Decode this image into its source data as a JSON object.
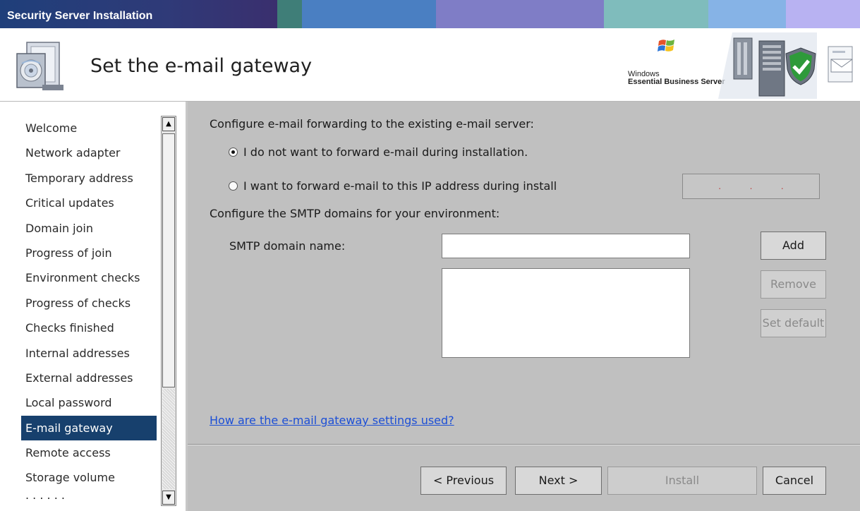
{
  "window": {
    "title": "Security Server Installation"
  },
  "colors": {
    "title_segments": [
      "#1f3f78",
      "#2d3b7c",
      "#3a2f6e",
      "#3f7e78",
      "#4a7fc2",
      "#7a7cc4",
      "#8f8dd0",
      "#7fbcbc",
      "#86b3e6",
      "#b4b0f0"
    ]
  },
  "header": {
    "page_title": "Set the e-mail gateway",
    "logo_line1": "Windows",
    "logo_line2": "Essential Business Server",
    "install_icon": "install-package-icon",
    "banner_icons": [
      "server-tower-icon",
      "shield-check-icon",
      "mail-envelope-icon"
    ]
  },
  "sidebar": {
    "items": [
      {
        "label": "Welcome"
      },
      {
        "label": "Network adapter"
      },
      {
        "label": "Temporary address"
      },
      {
        "label": "Critical updates"
      },
      {
        "label": "Domain join"
      },
      {
        "label": "Progress of join"
      },
      {
        "label": "Environment checks"
      },
      {
        "label": "Progress of checks"
      },
      {
        "label": "Checks finished"
      },
      {
        "label": "Internal addresses"
      },
      {
        "label": "External addresses"
      },
      {
        "label": "Local password"
      },
      {
        "label": "E-mail gateway"
      },
      {
        "label": "Remote access"
      },
      {
        "label": "Storage volume"
      },
      {
        "label": ". . . . . ."
      }
    ],
    "selected_index": 12,
    "scroll_up_glyph": "▲",
    "scroll_down_glyph": "▼"
  },
  "main": {
    "forward_heading": "Configure e-mail forwarding to the existing e-mail server:",
    "radio_no_forward": "I do not want to forward e-mail during installation.",
    "radio_forward": "I want to forward e-mail to this IP address during install",
    "selected_radio": "no_forward",
    "ip_dots": [
      ".",
      ".",
      "."
    ],
    "smtp_heading": "Configure the SMTP domains for your environment:",
    "smtp_label": "SMTP domain name:",
    "smtp_value": "",
    "add_label": "Add",
    "remove_label": "Remove",
    "set_default_label": "Set default",
    "help_link": "How are the e-mail gateway settings used?"
  },
  "footer": {
    "previous_label": "< Previous",
    "next_label": "Next >",
    "install_label": "Install",
    "cancel_label": "Cancel"
  }
}
